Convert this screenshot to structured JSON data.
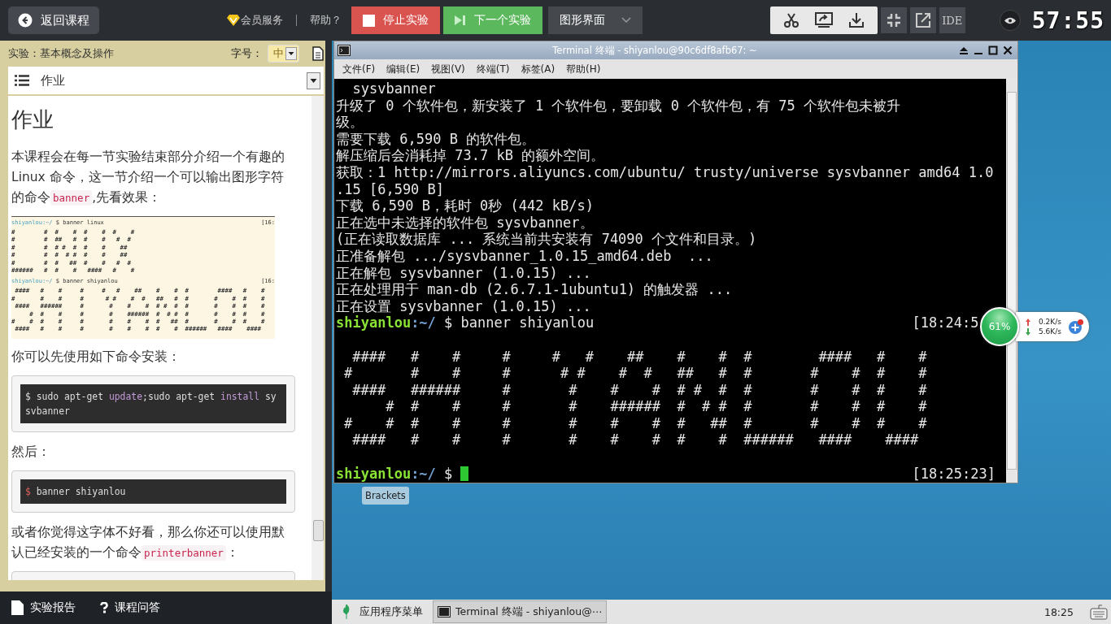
{
  "topbar": {
    "back": "返回课程",
    "vip": "会员服务",
    "help": "帮助？",
    "stop": "停止实验",
    "next": "下一个实验",
    "mode": "图形界面",
    "ide": "IDE",
    "timer": "57:55"
  },
  "lesson": {
    "title": "实验：基本概念及操作",
    "font_label": "字号：",
    "font_size": "中",
    "section": "作业",
    "heading": "作业",
    "blocks": [
      {
        "kind": "para",
        "parts": [
          {
            "text": "本课程会在每一节实验结束部分介绍一个有趣的 Linux 命令，这一节介绍一个可以输出图形字符的命令"
          },
          {
            "code": "banner"
          },
          {
            "text": ",先看效果："
          }
        ]
      },
      {
        "kind": "image",
        "sections": [
          {
            "user": "shiyanlou",
            "path": ":~/",
            "command": "$ banner linux",
            "time": "[16:",
            "rows": [
              "#        #  #    #  #    #  #    #",
              "#        #  ##   #  #    #   #  #",
              "#        #  # #  #  #    #    ##",
              "#        #  #  # #  #    #    ##",
              "#        #  #   ##  #    #   #  #",
              "######   #  #    #   ####   #    #"
            ]
          },
          {
            "user": "shiyanlou",
            "path": ":~/",
            "command": "$ banner shiyanlou",
            "time": "[16:",
            "rows": [
              " ####   #    #     #     #   #    ##    #    #  #        ####   #    #",
              "#       #    #     #      # #    #  #   ##   #  #       #    #  #    #",
              " ####   ######     #       #    #    #  # #  #  #       #    #  #    #",
              "     #  #    #     #       #    ######  #  # #  #       #    #  #    #",
              "#    #  #    #     #       #    #    #  #   ##  #       #    #  #    #",
              " ####   #    #     #       #    #    #  #    #  ######   ####    ####"
            ]
          }
        ]
      },
      {
        "kind": "para",
        "parts": [
          {
            "text": "你可以先使用如下命令安装："
          }
        ]
      },
      {
        "kind": "code",
        "parts": [
          {
            "text": "$ sudo apt-get "
          },
          {
            "keyword": "update"
          },
          {
            "text": ";sudo apt-get "
          },
          {
            "keyword": "install"
          },
          {
            "text": " sysvbanner"
          }
        ]
      },
      {
        "kind": "para",
        "parts": [
          {
            "text": "然后："
          }
        ]
      },
      {
        "kind": "code",
        "parts": [
          {
            "prompt": "$"
          },
          {
            "text": " banner shiyanlou"
          }
        ]
      },
      {
        "kind": "para",
        "parts": [
          {
            "text": "或者你觉得这字体不好看，那么你还可以使用默认已经安装的一个命令"
          },
          {
            "code": "printerbanner"
          },
          {
            "text": "："
          }
        ]
      },
      {
        "kind": "code_cut"
      }
    ]
  },
  "footer_tabs": [
    {
      "kind": "document",
      "label": "实验报告"
    },
    {
      "kind": "help",
      "label": "课程问答"
    }
  ],
  "terminal": {
    "title": "Terminal 终端 - shiyanlou@90c6df8afb67: ~",
    "menus": [
      "文件(F)",
      "编辑(E)",
      "视图(V)",
      "终端(T)",
      "标签(A)",
      "帮助(H)"
    ],
    "lines": [
      {
        "kind": "output",
        "text": "  sysvbanner"
      },
      {
        "kind": "output",
        "text": "升级了 0 个软件包，新安装了 1 个软件包，要卸载 0 个软件包，有 75 个软件包未被升"
      },
      {
        "kind": "output",
        "text": "级。"
      },
      {
        "kind": "output",
        "text": "需要下载 6,590 B 的软件包。"
      },
      {
        "kind": "output",
        "text": "解压缩后会消耗掉 73.7 kB 的额外空间。"
      },
      {
        "kind": "output",
        "text": "获取：1 http://mirrors.aliyuncs.com/ubuntu/ trusty/universe sysvbanner amd64 1.0"
      },
      {
        "kind": "output",
        "text": ".15 [6,590 B]"
      },
      {
        "kind": "output",
        "text": "下载 6,590 B，耗时 0秒 (442 kB/s)"
      },
      {
        "kind": "output",
        "text": "正在选中未选择的软件包 sysvbanner。"
      },
      {
        "kind": "output",
        "text": "(正在读取数据库 ... 系统当前共安装有 74090 个文件和目录。)"
      },
      {
        "kind": "output",
        "text": "正准备解包 .../sysvbanner_1.0.15_amd64.deb  ..."
      },
      {
        "kind": "output",
        "text": "正在解包 sysvbanner (1.0.15) ..."
      },
      {
        "kind": "output",
        "text": "正在处理用于 man-db (2.6.7.1-1ubuntu1) 的触发器 ..."
      },
      {
        "kind": "output",
        "text": "正在设置 sysvbanner (1.0.15) ..."
      },
      {
        "kind": "prompt",
        "user": "shiyanlou",
        "path": ":~/",
        "command": "$ banner shiyanlou",
        "time": "[18:24:5",
        "cursor": false
      },
      {
        "kind": "blank"
      },
      {
        "kind": "banner",
        "rows": [
          " ####   #    #     #     #   #    ##    #    #  #        ####   #    #",
          "#       #    #     #      # #    #  #   ##   #  #       #    #  #    #",
          " ####   ######     #       #    #    #  # #  #  #       #    #  #    #",
          "     #  #    #     #       #    ######  #  # #  #       #    #  #    #",
          "#    #  #    #     #       #    #    #  #   ##  #       #    #  #    #",
          " ####   #    #     #       #    #    #  #    #  ######   ####    ####"
        ]
      },
      {
        "kind": "blank"
      },
      {
        "kind": "prompt",
        "user": "shiyanlou",
        "path": ":~/",
        "command": "$",
        "time": "[18:25:23]",
        "cursor": true
      }
    ]
  },
  "desktop_icon": "Brackets",
  "monitor": {
    "percent": "61%",
    "up": "0.2K/s",
    "down": "5.6K/s"
  },
  "taskbar": {
    "menu": "应用程序菜单",
    "tasks": [
      {
        "label": "Terminal 终端 - shiyanlou@⋯",
        "selected": true
      }
    ],
    "clock": "18:25"
  }
}
